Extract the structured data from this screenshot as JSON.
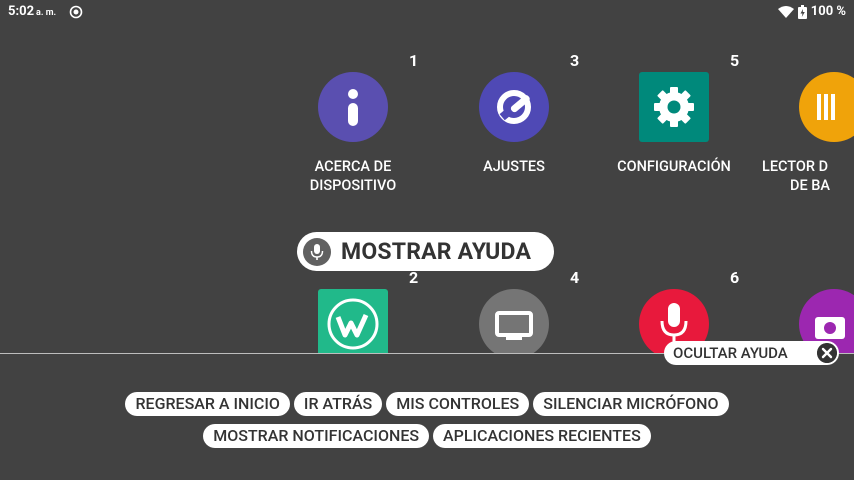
{
  "status_bar": {
    "time": "5:02",
    "ampm": "a. m.",
    "battery": "100 %"
  },
  "apps": [
    {
      "number": "1",
      "label_line1": "ACERCA DE",
      "label_line2": "DISPOSITIVO",
      "icon": "info-icon",
      "color": "#5a4fb0"
    },
    {
      "number": "3",
      "label_line1": "AJUSTES",
      "label_line2": "",
      "icon": "wrench-icon",
      "color": "#4f49b5"
    },
    {
      "number": "5",
      "label_line1": "CONFIGURACIÓN",
      "label_line2": "",
      "icon": "gear-icon",
      "color": "#00897b"
    },
    {
      "number": "",
      "label_line1": "LECTOR D",
      "label_line2": "DE BA",
      "icon": "barcode-icon",
      "color": "#f0a30a"
    },
    {
      "number": "2",
      "label_line1": "",
      "label_line2": "",
      "icon": "w-logo-icon",
      "color": "#21b98a"
    },
    {
      "number": "4",
      "label_line1": "",
      "label_line2": "",
      "icon": "monitor-icon",
      "color": "#757575"
    },
    {
      "number": "6",
      "label_line1": "",
      "label_line2": "",
      "icon": "microphone-icon",
      "color": "#e8193c"
    },
    {
      "number": "",
      "label_line1": "",
      "label_line2": "",
      "icon": "camera-icon",
      "color": "#9c27b0"
    }
  ],
  "mostrar_ayuda": "MOSTRAR AYUDA",
  "ocultar_ayuda": "OCULTAR AYUDA",
  "commands_row1": [
    "REGRESAR A INICIO",
    "IR ATRÁS",
    "MIS CONTROLES",
    "SILENCIAR MICRÓFONO"
  ],
  "commands_row2": [
    "MOSTRAR NOTIFICACIONES",
    "APLICACIONES RECIENTES"
  ]
}
